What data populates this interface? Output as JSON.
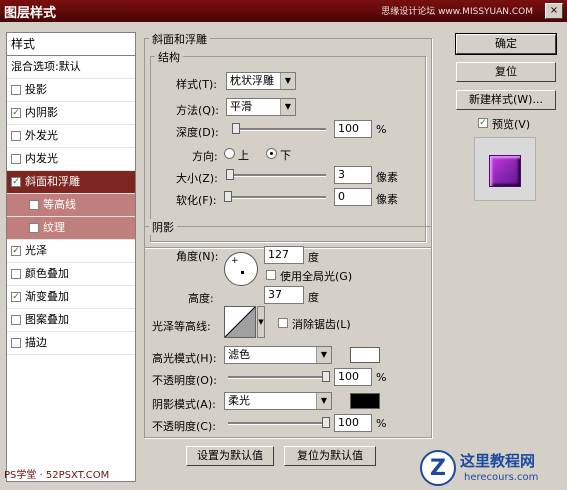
{
  "window": {
    "title": "图层样式",
    "watermark": "思缘设计论坛 www.MISSYUAN.COM",
    "close_glyph": "×"
  },
  "left_panel": {
    "header": "样式",
    "items": [
      {
        "label": "混合选项:默认",
        "checkbox": false,
        "checked": false
      },
      {
        "label": "投影",
        "checkbox": true,
        "checked": false
      },
      {
        "label": "内阴影",
        "checkbox": true,
        "checked": true
      },
      {
        "label": "外发光",
        "checkbox": true,
        "checked": false
      },
      {
        "label": "内发光",
        "checkbox": true,
        "checked": false
      },
      {
        "label": "斜面和浮雕",
        "checkbox": true,
        "checked": true,
        "selected": true
      },
      {
        "label": "等高线",
        "checkbox": true,
        "checked": false,
        "sub": true
      },
      {
        "label": "纹理",
        "checkbox": true,
        "checked": false,
        "sub": true
      },
      {
        "label": "光泽",
        "checkbox": true,
        "checked": true
      },
      {
        "label": "颜色叠加",
        "checkbox": true,
        "checked": false
      },
      {
        "label": "渐变叠加",
        "checkbox": true,
        "checked": true
      },
      {
        "label": "图案叠加",
        "checkbox": true,
        "checked": false
      },
      {
        "label": "描边",
        "checkbox": true,
        "checked": false
      }
    ]
  },
  "bevel": {
    "section_title": "斜面和浮雕",
    "structure_title": "结构",
    "style_label": "样式(T):",
    "style_value": "枕状浮雕",
    "technique_label": "方法(Q):",
    "technique_value": "平滑",
    "depth_label": "深度(D):",
    "depth_value": "100",
    "depth_unit": "%",
    "depth_level": 0.0,
    "direction_label": "方向:",
    "direction_up": "上",
    "direction_down": "下",
    "direction_selected": "下",
    "size_label": "大小(Z):",
    "size_value": "3",
    "size_unit": "像素",
    "size_level": 0.02,
    "soften_label": "软化(F):",
    "soften_value": "0",
    "soften_unit": "像素",
    "soften_level": 0.0
  },
  "shading": {
    "title": "阴影",
    "angle_label": "角度(N):",
    "angle_value": "127",
    "angle_unit": "度",
    "global_light_label": "使用全局光(G)",
    "global_light_checked": false,
    "altitude_label": "高度:",
    "altitude_value": "37",
    "altitude_unit": "度",
    "gloss_label": "光泽等高线:",
    "antialias_label": "消除锯齿(L)",
    "antialias_checked": false,
    "highlight_label": "高光模式(H):",
    "highlight_mode": "滤色",
    "highlight_color": "#ffffff",
    "highlight_opacity_label": "不透明度(O):",
    "highlight_opacity": "100",
    "highlight_opacity_level": 1.0,
    "shadow_label": "阴影模式(A):",
    "shadow_mode": "柔光",
    "shadow_color": "#000000",
    "shadow_opacity_label": "不透明度(C):",
    "shadow_opacity": "100",
    "shadow_opacity_level": 1.0,
    "percent": "%"
  },
  "bottom_buttons": {
    "make_default": "设置为默认值",
    "reset_default": "复位为默认值"
  },
  "right": {
    "ok": "确定",
    "reset": "复位",
    "new_style": "新建样式(W)...",
    "preview_label": "预览(V)",
    "preview_checked": true,
    "preview_colors": {
      "top_left": "#c43ae0",
      "bottom_right": "#5a1490"
    }
  },
  "footer": {
    "ps_watermark": "PS学堂 · 52PSXT.COM",
    "logo_letter": "Z",
    "logo_name": "这里教程网",
    "logo_url": "herecours.com"
  }
}
